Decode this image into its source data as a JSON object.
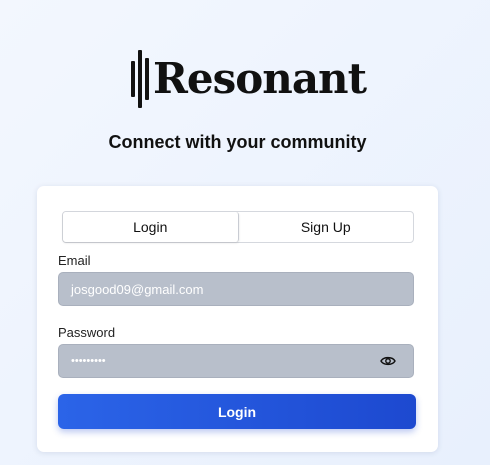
{
  "brand": {
    "name": "Resonant",
    "logo_icon": "sound-bars-icon"
  },
  "tagline": "Connect with your community",
  "tabs": [
    {
      "label": "Login",
      "active": true
    },
    {
      "label": "Sign Up",
      "active": false
    }
  ],
  "form": {
    "email_label": "Email",
    "email_value": "josgood09@gmail.com",
    "password_label": "Password",
    "password_value": "•••••••••",
    "password_toggle_icon": "eye-icon",
    "submit_label": "Login"
  },
  "colors": {
    "accent": "#2559dd",
    "field_bg": "#b8bfcb",
    "page_bg": "#eaf1fd"
  }
}
